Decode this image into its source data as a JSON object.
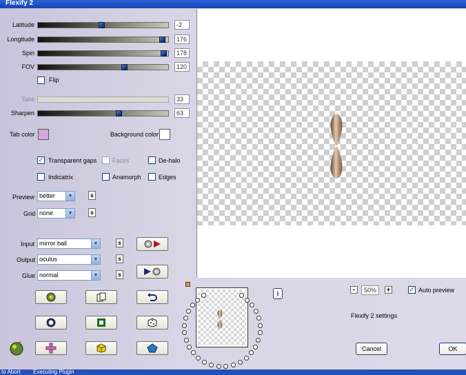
{
  "window": {
    "title": "Flexify 2"
  },
  "sliders": [
    {
      "label": "Latitude",
      "value": "-2",
      "level": 0.49,
      "disabled": false
    },
    {
      "label": "Longitude",
      "value": "176",
      "level": 0.98,
      "disabled": false
    },
    {
      "label": "Spin",
      "value": "178",
      "level": 0.99,
      "disabled": false
    },
    {
      "label": "FOV",
      "value": "120",
      "level": 0.67,
      "disabled": false
    },
    {
      "label": "Tabs",
      "value": "33",
      "level": 0.0,
      "disabled": true
    },
    {
      "label": "Sharpen",
      "value": "63",
      "level": 0.63,
      "disabled": false
    }
  ],
  "flip": {
    "label": "Flip",
    "checked": false
  },
  "colors": {
    "tab_color_label": "Tab color",
    "tab_color": "#d8a8d8",
    "background_color_label": "Background color",
    "background_color": "#ffffff"
  },
  "options": {
    "transparent_gaps": {
      "label": "Transparent gaps",
      "checked": true
    },
    "faces": {
      "label": "Faces",
      "checked": false
    },
    "de_halo": {
      "label": "De-halo",
      "checked": false
    },
    "indicatrix": {
      "label": "Indicatrix",
      "checked": false
    },
    "anamorph": {
      "label": "Anamorph",
      "checked": false
    },
    "edges": {
      "label": "Edges",
      "checked": false
    }
  },
  "preview_select": {
    "label": "Preview",
    "value": "better"
  },
  "grid_select": {
    "label": "Grid",
    "value": "none"
  },
  "input_select": {
    "label": "Input",
    "value": "mirror ball"
  },
  "output_select": {
    "label": "Output",
    "value": "oculus"
  },
  "glue_select": {
    "label": "Glue",
    "value": "normal"
  },
  "s_button_label": "s",
  "info_label": "i",
  "zoom": {
    "minus": "-",
    "value": "50%",
    "plus": "+"
  },
  "auto_preview": {
    "label": "Auto preview",
    "checked": true
  },
  "settings_label": "Flexify 2 settings",
  "cancel_label": "Cancel",
  "ok_label": "OK",
  "taskbar": {
    "item1": "to Abort",
    "item2": "Executing Plugin"
  },
  "accent": "#1b4fc2"
}
